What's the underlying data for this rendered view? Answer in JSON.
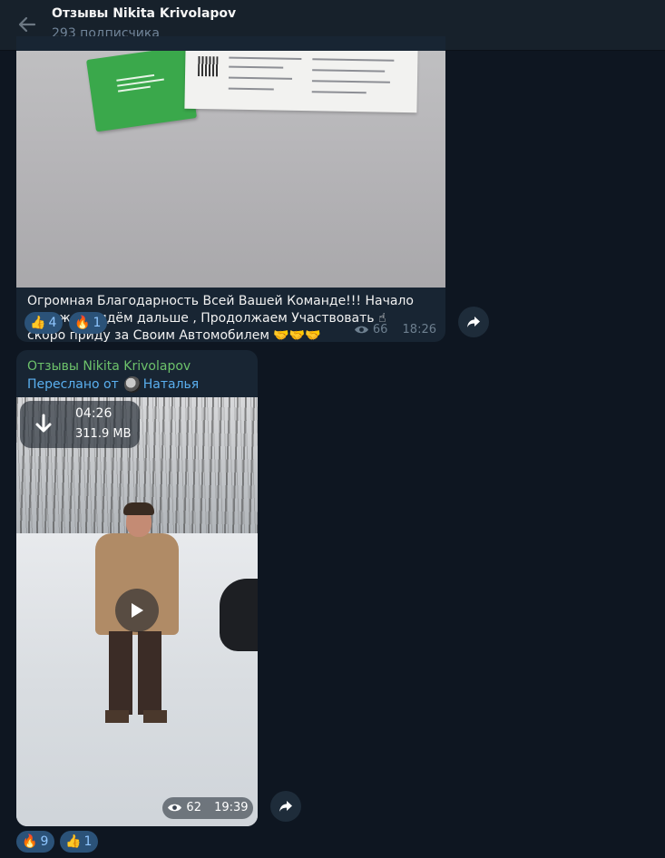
{
  "header": {
    "title": "Отзывы Nikita Krivolapov",
    "subtitle": "293 подписчика"
  },
  "messages": [
    {
      "text": "Огромная Благодарность Всей Вашей Команде!!! Начало положено идём дальше , Продолжаем Участвовать ☝ скоро приду за Своим Автомобилем 🤝🤝🤝",
      "reactions": [
        {
          "emoji": "👍",
          "count": "4"
        },
        {
          "emoji": "🔥",
          "count": "1"
        }
      ],
      "views": "66",
      "time": "18:26"
    },
    {
      "channel": "Отзывы Nikita Krivolapov",
      "forwarded_label": "Переслано от",
      "forwarded_from": "Наталья",
      "video": {
        "duration": "04:26",
        "size": "311.9 MB"
      },
      "reactions": [
        {
          "emoji": "🔥",
          "count": "9"
        },
        {
          "emoji": "👍",
          "count": "1"
        }
      ],
      "views": "62",
      "time": "19:39"
    }
  ],
  "colors": {
    "background": "#0e1621",
    "header": "#17212b",
    "bubble": "#182533",
    "accent_link": "#5aafef",
    "channel_name": "#6dc26b",
    "reaction_bg": "#2b5278"
  },
  "icons": [
    "back-arrow-icon",
    "eye-icon",
    "share-icon",
    "download-icon",
    "play-icon"
  ]
}
